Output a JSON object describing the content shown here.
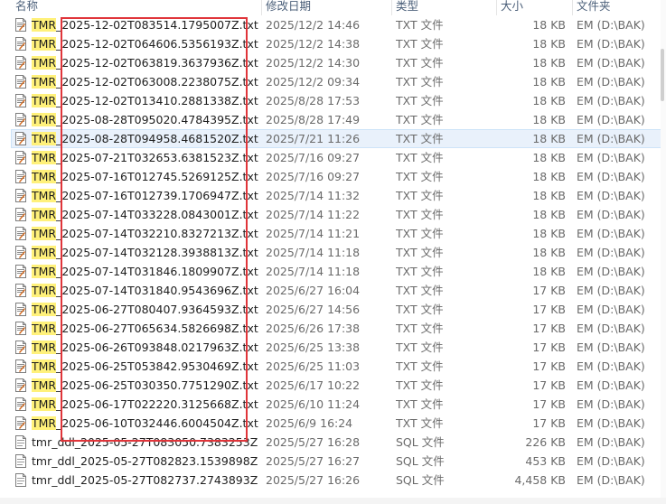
{
  "columns": {
    "name": "名称",
    "date": "修改日期",
    "type": "类型",
    "size": "大小",
    "location": "文件夹"
  },
  "files": [
    {
      "name_prefix": "TMR",
      "name_rest": "_2025-12-02T083514.1795007Z.txt",
      "date": "2025/12/2 14:46",
      "type": "TXT 文件",
      "size": "18 KB",
      "location": "EM (D:\\BAK)",
      "icon": "text-file-icon"
    },
    {
      "name_prefix": "TMR",
      "name_rest": "_2025-12-02T064606.5356193Z.txt",
      "date": "2025/12/2 14:38",
      "type": "TXT 文件",
      "size": "18 KB",
      "location": "EM (D:\\BAK)",
      "icon": "text-file-icon"
    },
    {
      "name_prefix": "TMR",
      "name_rest": "_2025-12-02T063819.3637936Z.txt",
      "date": "2025/12/2 14:30",
      "type": "TXT 文件",
      "size": "18 KB",
      "location": "EM (D:\\BAK)",
      "icon": "text-file-icon"
    },
    {
      "name_prefix": "TMR",
      "name_rest": "_2025-12-02T063008.2238075Z.txt",
      "date": "2025/12/2 09:34",
      "type": "TXT 文件",
      "size": "18 KB",
      "location": "EM (D:\\BAK)",
      "icon": "text-file-icon"
    },
    {
      "name_prefix": "TMR",
      "name_rest": "_2025-12-02T013410.2881338Z.txt",
      "date": "2025/8/28 17:53",
      "type": "TXT 文件",
      "size": "18 KB",
      "location": "EM (D:\\BAK)",
      "icon": "text-file-icon"
    },
    {
      "name_prefix": "TMR",
      "name_rest": "_2025-08-28T095020.4784395Z.txt",
      "date": "2025/8/28 17:49",
      "type": "TXT 文件",
      "size": "18 KB",
      "location": "EM (D:\\BAK)",
      "icon": "text-file-icon"
    },
    {
      "name_prefix": "TMR",
      "name_rest": "_2025-08-28T094958.4681520Z.txt",
      "date": "2025/7/21 11:26",
      "type": "TXT 文件",
      "size": "18 KB",
      "location": "EM (D:\\BAK)",
      "icon": "text-file-icon",
      "selected": true
    },
    {
      "name_prefix": "TMR",
      "name_rest": "_2025-07-21T032653.6381523Z.txt",
      "date": "2025/7/16 09:27",
      "type": "TXT 文件",
      "size": "18 KB",
      "location": "EM (D:\\BAK)",
      "icon": "text-file-icon"
    },
    {
      "name_prefix": "TMR",
      "name_rest": "_2025-07-16T012745.5269125Z.txt",
      "date": "2025/7/16 09:27",
      "type": "TXT 文件",
      "size": "18 KB",
      "location": "EM (D:\\BAK)",
      "icon": "text-file-icon"
    },
    {
      "name_prefix": "TMR",
      "name_rest": "_2025-07-16T012739.1706947Z.txt",
      "date": "2025/7/14 11:32",
      "type": "TXT 文件",
      "size": "18 KB",
      "location": "EM (D:\\BAK)",
      "icon": "text-file-icon"
    },
    {
      "name_prefix": "TMR",
      "name_rest": "_2025-07-14T033228.0843001Z.txt",
      "date": "2025/7/14 11:22",
      "type": "TXT 文件",
      "size": "18 KB",
      "location": "EM (D:\\BAK)",
      "icon": "text-file-icon"
    },
    {
      "name_prefix": "TMR",
      "name_rest": "_2025-07-14T032210.8327213Z.txt",
      "date": "2025/7/14 11:21",
      "type": "TXT 文件",
      "size": "18 KB",
      "location": "EM (D:\\BAK)",
      "icon": "text-file-icon"
    },
    {
      "name_prefix": "TMR",
      "name_rest": "_2025-07-14T032128.3938813Z.txt",
      "date": "2025/7/14 11:18",
      "type": "TXT 文件",
      "size": "18 KB",
      "location": "EM (D:\\BAK)",
      "icon": "text-file-icon"
    },
    {
      "name_prefix": "TMR",
      "name_rest": "_2025-07-14T031846.1809907Z.txt",
      "date": "2025/7/14 11:18",
      "type": "TXT 文件",
      "size": "18 KB",
      "location": "EM (D:\\BAK)",
      "icon": "text-file-icon"
    },
    {
      "name_prefix": "TMR",
      "name_rest": "_2025-07-14T031840.9543696Z.txt",
      "date": "2025/6/27 16:04",
      "type": "TXT 文件",
      "size": "17 KB",
      "location": "EM (D:\\BAK)",
      "icon": "text-file-icon"
    },
    {
      "name_prefix": "TMR",
      "name_rest": "_2025-06-27T080407.9364593Z.txt",
      "date": "2025/6/27 14:56",
      "type": "TXT 文件",
      "size": "17 KB",
      "location": "EM (D:\\BAK)",
      "icon": "text-file-icon"
    },
    {
      "name_prefix": "TMR",
      "name_rest": "_2025-06-27T065634.5826698Z.txt",
      "date": "2025/6/26 17:38",
      "type": "TXT 文件",
      "size": "17 KB",
      "location": "EM (D:\\BAK)",
      "icon": "text-file-icon"
    },
    {
      "name_prefix": "TMR",
      "name_rest": "_2025-06-26T093848.0217963Z.txt",
      "date": "2025/6/25 13:38",
      "type": "TXT 文件",
      "size": "17 KB",
      "location": "EM (D:\\BAK)",
      "icon": "text-file-icon"
    },
    {
      "name_prefix": "TMR",
      "name_rest": "_2025-06-25T053842.9530469Z.txt",
      "date": "2025/6/25 11:03",
      "type": "TXT 文件",
      "size": "17 KB",
      "location": "EM (D:\\BAK)",
      "icon": "text-file-icon"
    },
    {
      "name_prefix": "TMR",
      "name_rest": "_2025-06-25T030350.7751290Z.txt",
      "date": "2025/6/17 10:22",
      "type": "TXT 文件",
      "size": "17 KB",
      "location": "EM (D:\\BAK)",
      "icon": "text-file-icon"
    },
    {
      "name_prefix": "TMR",
      "name_rest": "_2025-06-17T022220.3125668Z.txt",
      "date": "2025/6/10 11:24",
      "type": "TXT 文件",
      "size": "17 KB",
      "location": "EM (D:\\BAK)",
      "icon": "text-file-icon"
    },
    {
      "name_prefix": "TMR",
      "name_rest": "_2025-06-10T032446.6004504Z.txt",
      "date": "2025/6/9 16:24",
      "type": "TXT 文件",
      "size": "17 KB",
      "location": "EM (D:\\BAK)",
      "icon": "text-file-icon"
    },
    {
      "name_prefix": "",
      "name_rest": "tmr_ddl_2025-05-27T083050.7383253Z.sql",
      "date": "2025/5/27 16:28",
      "type": "SQL 文件",
      "size": "226 KB",
      "location": "EM (D:\\BAK)",
      "icon": "sql-file-icon"
    },
    {
      "name_prefix": "",
      "name_rest": "tmr_ddl_2025-05-27T082823.1539898Z.sql",
      "date": "2025/5/27 16:27",
      "type": "SQL 文件",
      "size": "453 KB",
      "location": "EM (D:\\BAK)",
      "icon": "sql-file-icon"
    },
    {
      "name_prefix": "",
      "name_rest": "tmr_ddl_2025-05-27T082737.2743893Z.sql",
      "date": "2025/5/27 16:26",
      "type": "SQL 文件",
      "size": "4,458 KB",
      "location": "EM (D:\\BAK)",
      "icon": "sql-file-icon"
    }
  ],
  "colors": {
    "highlight": "#fff17a",
    "annotation_box": "#e0353a",
    "selected_row": "#e9f1fb"
  }
}
